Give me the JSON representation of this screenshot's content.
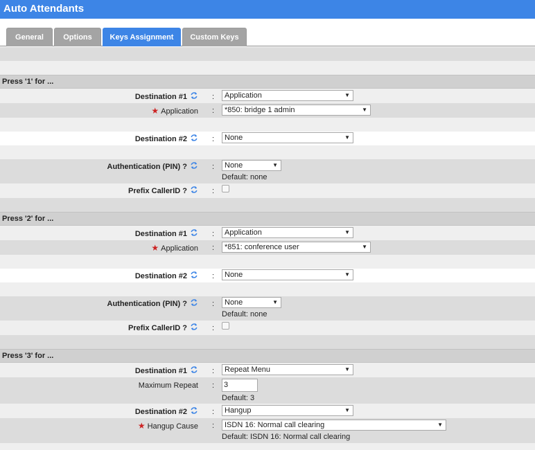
{
  "title": "Auto Attendants",
  "tabs": [
    {
      "label": "General",
      "active": false
    },
    {
      "label": "Options",
      "active": false
    },
    {
      "label": "Keys Assignment",
      "active": true
    },
    {
      "label": "Custom Keys",
      "active": false
    }
  ],
  "colors": {
    "accent": "#3d85e6",
    "required": "#cc2222"
  },
  "sections": [
    {
      "header": "Press '1' for ...",
      "dest1_label": "Destination #1",
      "dest1_value": "Application",
      "app_label": "Application",
      "app_value": "*850: bridge 1 admin",
      "dest2_label": "Destination #2",
      "dest2_value": "None",
      "auth_label": "Authentication (PIN) ?",
      "auth_value": "None",
      "auth_default": "Default: none",
      "prefix_label": "Prefix CallerID ?",
      "prefix_checked": false
    },
    {
      "header": "Press '2' for ...",
      "dest1_label": "Destination #1",
      "dest1_value": "Application",
      "app_label": "Application",
      "app_value": "*851: conference user",
      "dest2_label": "Destination #2",
      "dest2_value": "None",
      "auth_label": "Authentication (PIN) ?",
      "auth_value": "None",
      "auth_default": "Default: none",
      "prefix_label": "Prefix CallerID ?",
      "prefix_checked": false
    },
    {
      "header": "Press '3' for ...",
      "dest1_label": "Destination #1",
      "dest1_value": "Repeat Menu",
      "max_repeat_label": "Maximum Repeat",
      "max_repeat_value": "3",
      "max_repeat_default": "Default: 3",
      "dest2_label": "Destination #2",
      "dest2_value": "Hangup",
      "hangup_label": "Hangup Cause",
      "hangup_value": "ISDN 16: Normal call clearing",
      "hangup_default": "Default: ISDN 16: Normal call clearing"
    }
  ]
}
